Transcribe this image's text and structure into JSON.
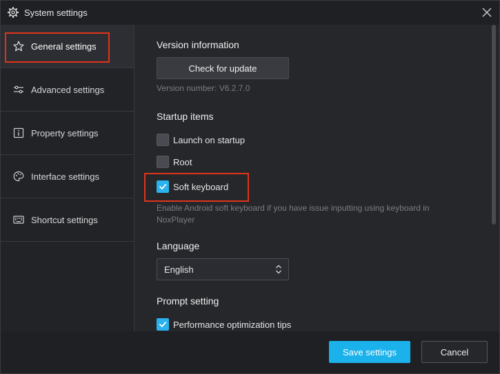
{
  "window": {
    "title": "System settings",
    "title_icon": "gear-icon",
    "close_icon": "close-icon"
  },
  "sidebar": {
    "items": [
      {
        "label": "General settings",
        "icon": "star-icon",
        "active": true
      },
      {
        "label": "Advanced settings",
        "icon": "sliders-icon",
        "active": false
      },
      {
        "label": "Property settings",
        "icon": "info-icon",
        "active": false
      },
      {
        "label": "Interface settings",
        "icon": "palette-icon",
        "active": false
      },
      {
        "label": "Shortcut settings",
        "icon": "keyboard-icon",
        "active": false
      }
    ]
  },
  "content": {
    "version": {
      "title": "Version information",
      "button": "Check for update",
      "number": "Version number: V6.2.7.0"
    },
    "startup": {
      "title": "Startup items",
      "items": [
        {
          "label": "Launch on startup",
          "checked": false
        },
        {
          "label": "Root",
          "checked": false
        },
        {
          "label": "Soft keyboard",
          "checked": true
        }
      ],
      "hint_line1": "Enable Android soft keyboard if you have issue inputting using keyboard in",
      "hint_line2": "NoxPlayer"
    },
    "language": {
      "title": "Language",
      "selected": "English"
    },
    "prompt": {
      "title": "Prompt setting",
      "items": [
        {
          "label": "Performance optimization tips",
          "checked": true
        }
      ]
    }
  },
  "footer": {
    "save": "Save settings",
    "cancel": "Cancel"
  },
  "colors": {
    "accent": "#1bb1ea",
    "checkbox_checked": "#2ab2ee",
    "highlight": "#e0341a",
    "background": "#26272b"
  }
}
